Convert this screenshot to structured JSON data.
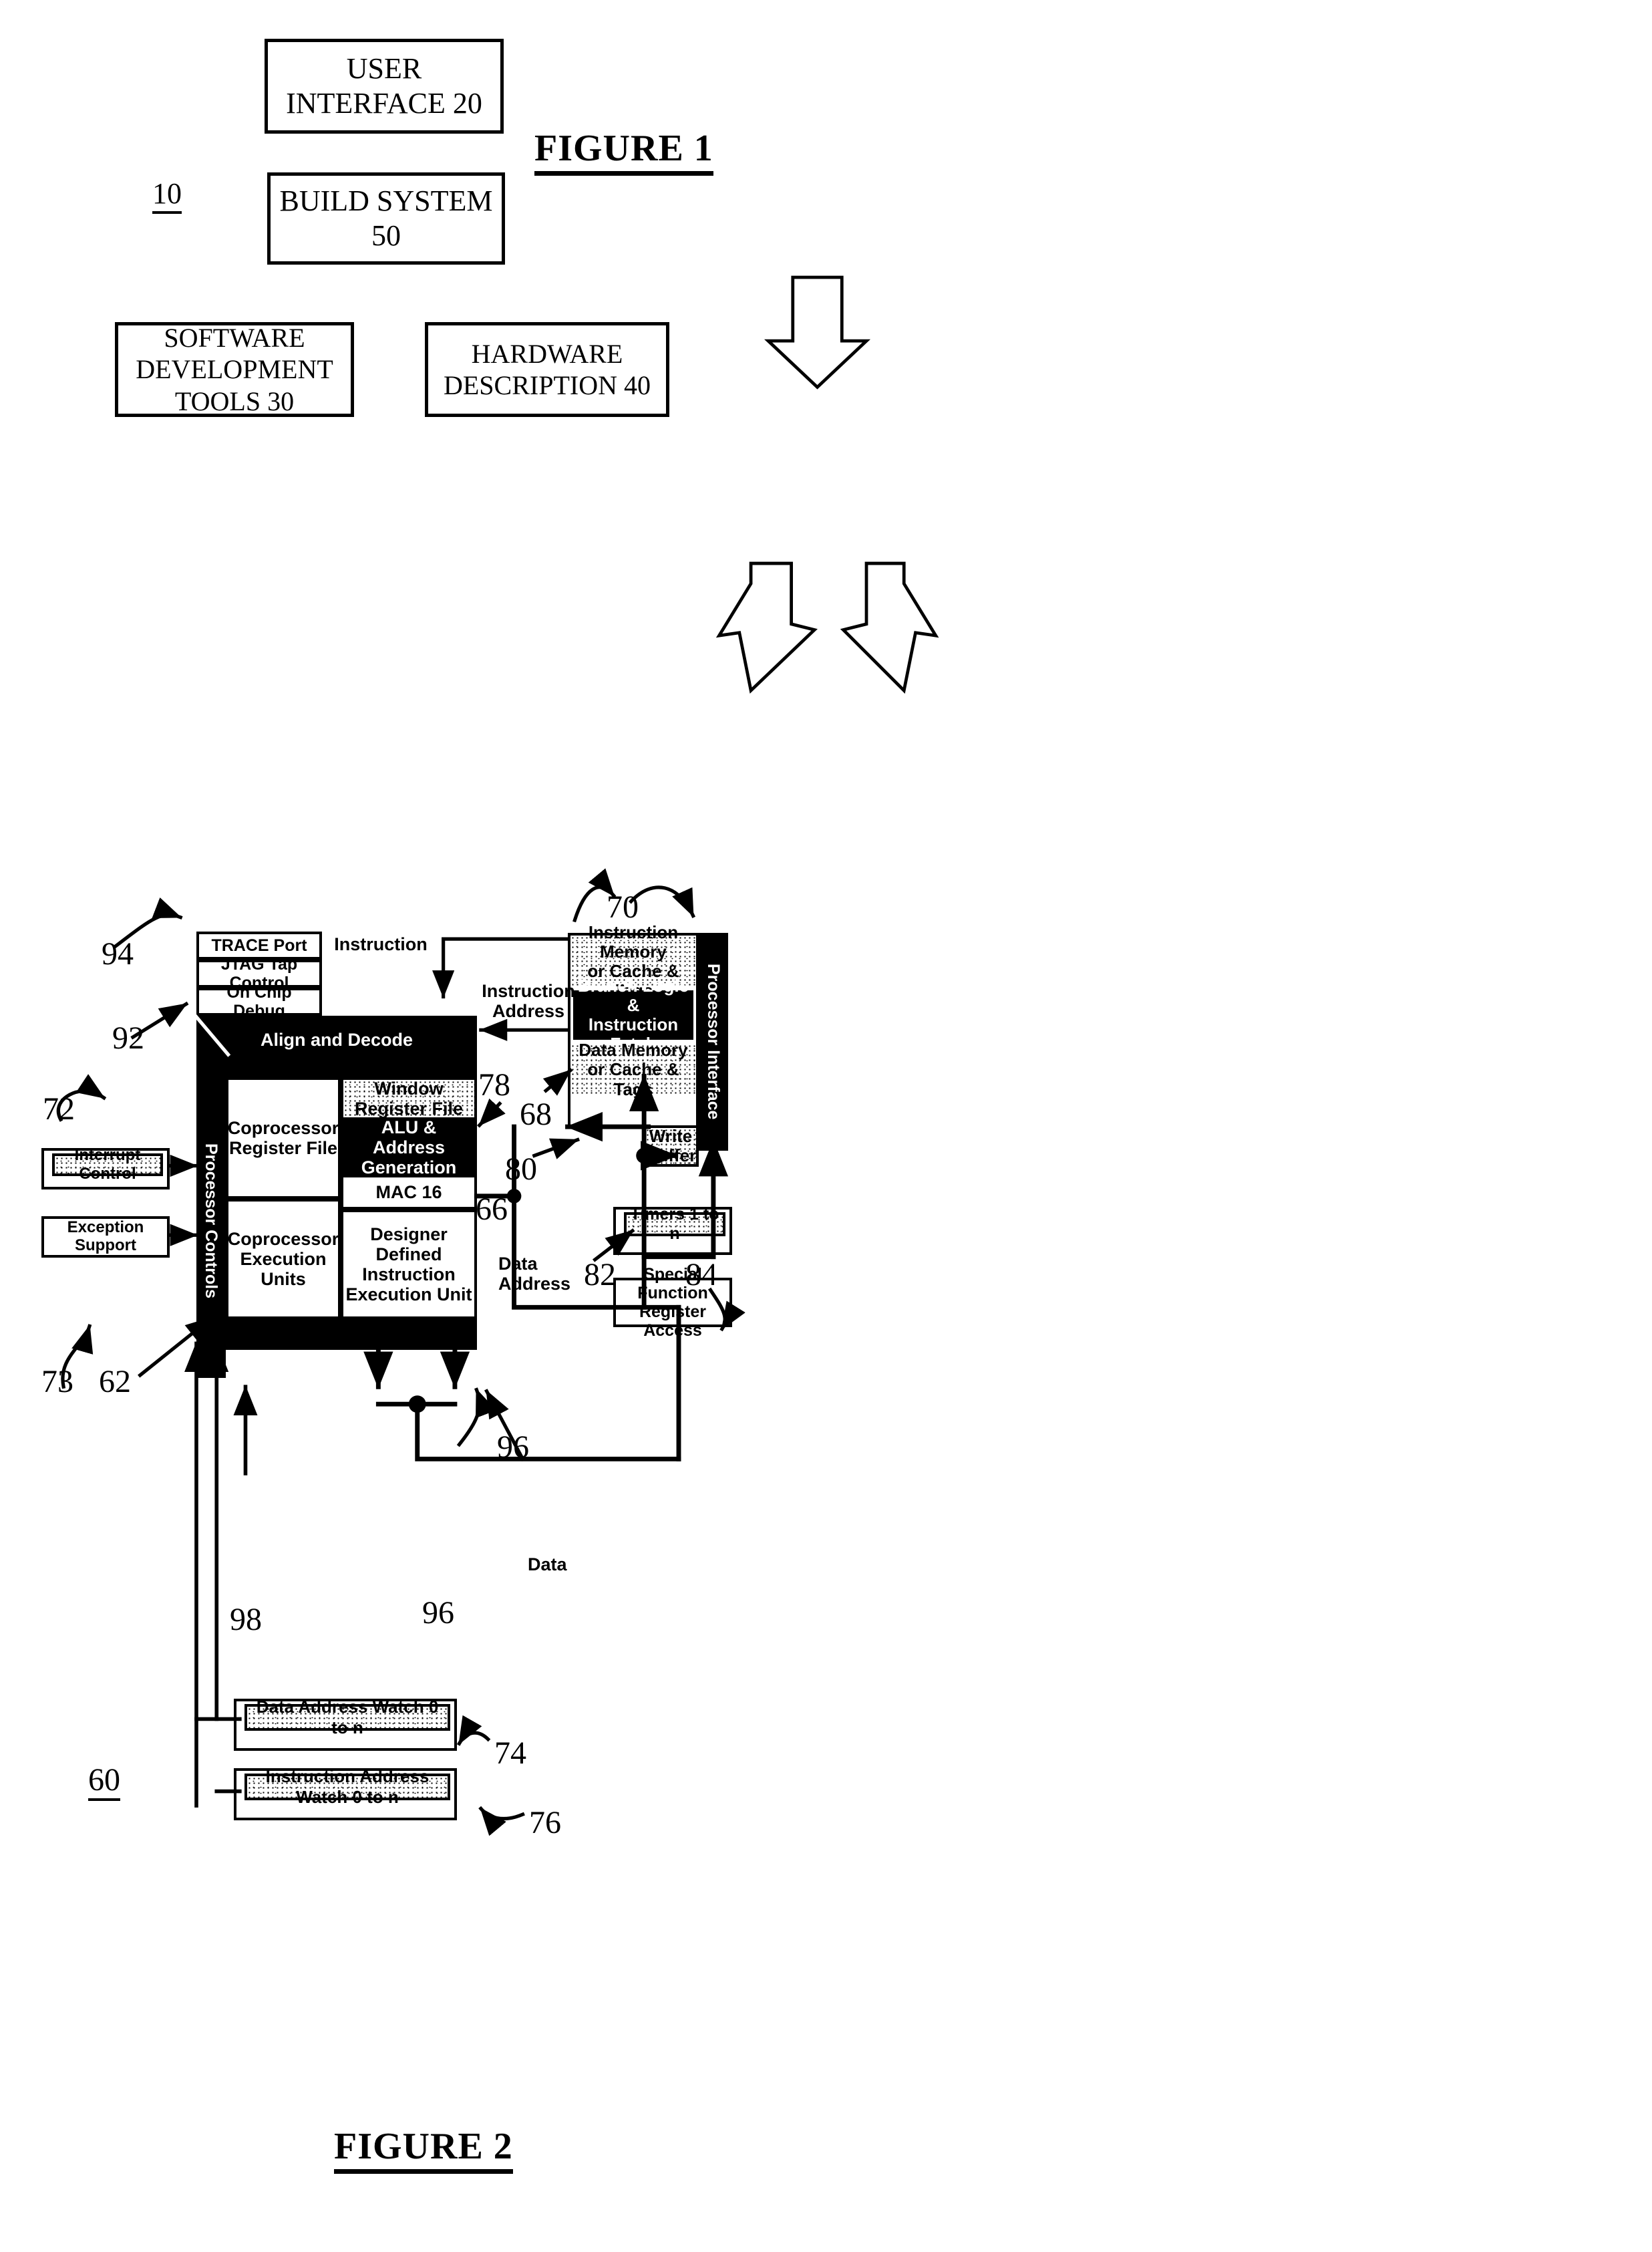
{
  "figure1": {
    "title": "FIGURE 1",
    "system_ref": "10",
    "boxes": [
      {
        "id": "user_interface",
        "lines": [
          "USER",
          "INTERFACE 20"
        ]
      },
      {
        "id": "build_system",
        "lines": [
          "BUILD SYSTEM",
          "50"
        ]
      },
      {
        "id": "software_tools",
        "lines": [
          "SOFTWARE",
          "DEVELOPMENT",
          "TOOLS 30"
        ]
      },
      {
        "id": "hardware_desc",
        "lines": [
          "HARDWARE",
          "DESCRIPTION 40"
        ]
      }
    ]
  },
  "figure2": {
    "title": "FIGURE 2",
    "system_ref": "60",
    "blocks": {
      "trace_port": "TRACE Port",
      "jtag_tap_control": "JTAG Tap Control",
      "on_chip_debug": "On Chip Debug",
      "align_and_decode": "Align and Decode",
      "processor_controls": "Processor Controls",
      "coprocessor_register_file": "Coprocessor\nRegister File",
      "coprocessor_execution_units": "Coprocessor\nExecution Units",
      "window_register_file": "Window\nRegister File",
      "alu_address_generation": "ALU &\nAddress Generation",
      "mac16": "MAC 16",
      "designer_defined_unit": "Designer Defined\nInstruction\nExecution Unit",
      "interrupt_control": "Interrupt Control",
      "exception_support": "Exception Support",
      "instruction_memory": "Instruction Memory\nor Cache & Tags",
      "branch_logic": "Branch Logic &\nInstruction Fetch",
      "data_memory": "Data Memory\nor Cache & Tags",
      "processor_interface": "Processor Interface",
      "write_buffer": "Write\nBuffer",
      "timers": "Timers 1 to n",
      "special_function_register_access": "Special Function\nRegister Access",
      "data_address_watch": "Data Address Watch 0 to n",
      "instruction_address_watch": "Instruction Address Watch 0 to n"
    },
    "signal_labels": {
      "instruction": "Instruction",
      "instruction_address": "Instruction\nAddress",
      "data_address": "Data\nAddress",
      "data": "Data"
    },
    "ref_numbers": {
      "n62": "62",
      "n66": "66",
      "n68": "68",
      "n70": "70",
      "n72": "72",
      "n73": "73",
      "n74": "74",
      "n76": "76",
      "n78": "78",
      "n80": "80",
      "n82": "82",
      "n84": "84",
      "n92": "92",
      "n94": "94",
      "n96a": "96",
      "n96b": "96",
      "n98": "98"
    }
  }
}
